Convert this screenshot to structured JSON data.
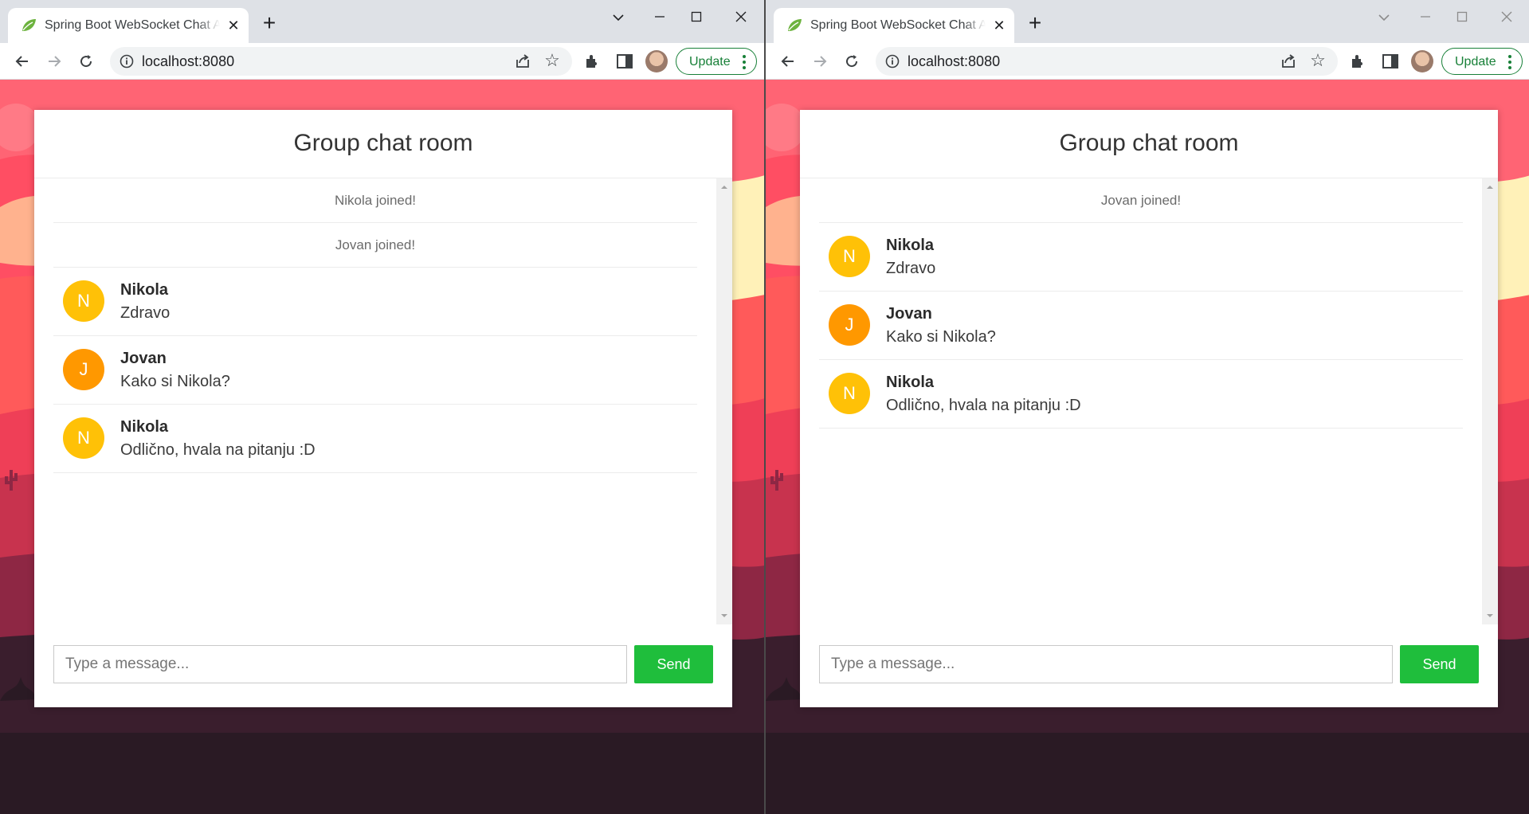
{
  "windows": [
    {
      "tab": {
        "title": "Spring Boot WebSocket Chat App",
        "close_glyph": "✕"
      },
      "address": {
        "url": "localhost:8080"
      },
      "update_label": "Update",
      "chat": {
        "title": "Group chat room",
        "events": [
          "Nikola joined!",
          "Jovan joined!"
        ],
        "messages": [
          {
            "sender": "Nikola",
            "initial": "N",
            "text": "Zdravo",
            "avatar_color": "#ffc107"
          },
          {
            "sender": "Jovan",
            "initial": "J",
            "text": "Kako si Nikola?",
            "avatar_color": "#ff9800"
          },
          {
            "sender": "Nikola",
            "initial": "N",
            "text": "Odlično, hvala na pitanju :D",
            "avatar_color": "#ffc107"
          }
        ],
        "input_placeholder": "Type a message...",
        "send_label": "Send"
      }
    },
    {
      "tab": {
        "title": "Spring Boot WebSocket Chat App",
        "close_glyph": "✕"
      },
      "address": {
        "url": "localhost:8080"
      },
      "update_label": "Update",
      "chat": {
        "title": "Group chat room",
        "events": [
          "Jovan joined!"
        ],
        "messages": [
          {
            "sender": "Nikola",
            "initial": "N",
            "text": "Zdravo",
            "avatar_color": "#ffc107"
          },
          {
            "sender": "Jovan",
            "initial": "J",
            "text": "Kako si Nikola?",
            "avatar_color": "#ff9800"
          },
          {
            "sender": "Nikola",
            "initial": "N",
            "text": "Odlično, hvala na pitanju :D",
            "avatar_color": "#ffc107"
          }
        ],
        "input_placeholder": "Type a message...",
        "send_label": "Send"
      }
    }
  ],
  "colors": {
    "send_button": "#1fbe3c",
    "update_accent": "#188038",
    "background_top": "#ff5a6e",
    "background_bottom": "#2a1a24"
  },
  "icons": [
    "spring-leaf-icon",
    "new-tab-icon",
    "chevron-down-icon",
    "minimize-icon",
    "maximize-icon",
    "close-icon",
    "back-arrow-icon",
    "forward-arrow-icon",
    "reload-icon",
    "info-icon",
    "share-icon",
    "star-icon",
    "extensions-icon",
    "side-panel-icon",
    "profile-avatar",
    "kebab-menu-icon",
    "scroll-up-icon",
    "scroll-down-icon"
  ]
}
